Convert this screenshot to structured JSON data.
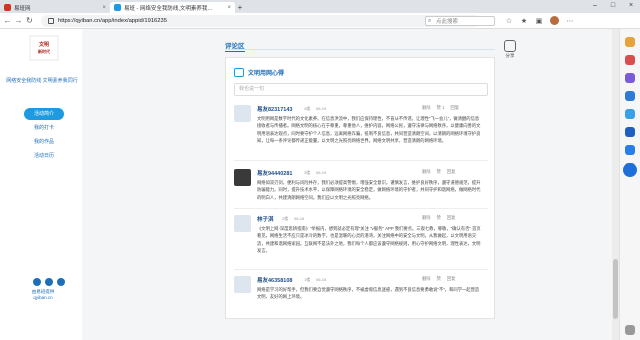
{
  "browser": {
    "tabs": [
      {
        "title": "易班网",
        "active": false
      },
      {
        "title": "易班 - 网络安全我防线,文明素养我…",
        "active": true
      }
    ],
    "url": "https://qyiban.cn/app/index/appid/1916235",
    "search_placeholder": "点此搜索"
  },
  "sidebar": {
    "logo_text": "文明新时代",
    "site_name": "网络安全我防线 文明素养我同行",
    "menu": [
      "活动简介",
      "我的打卡",
      "我的作品",
      "活动日历"
    ],
    "footer_line1": "由易班提供",
    "footer_line2": "qyiban.cn"
  },
  "main": {
    "section_title": "评论区",
    "share_label": "分享",
    "card_title": "文明用网心得",
    "input_placeholder": "我也说一句",
    "posts": [
      {
        "name": "易友82317143",
        "meta1": "4楼",
        "meta2": "06-19",
        "actions": [
          "删除",
          "赞 1",
          "回复"
        ],
        "body": "文明用网是数字时代的文化素养。在信息洪流中，我们应保持理性，不盲从不传谣，让理性\"飞一会儿\"，做清醒的信息接收者与传播者。网络文明的核心在于尊重，尊重他人，维护内容。网络公民，遵守法律与网络秩序，以健康向善的文明用语表达观点，同时要守护个人信息，远离网络诈骗，抵制不良信息，共同营造清朗空间，以清朗的网络环境守护良知，让每一条评论都传递正能量，以文明之光照亮网络世界。网络文明共享，营造清朗的网络环境。"
      },
      {
        "name": "易友94440281",
        "meta1": "3楼",
        "meta2": "06-19",
        "actions": [
          "删除",
          "赞",
          "回复"
        ],
        "body": "网络如双刃剑，便利与风险并存，我们必须提高警惕，增强安全意识，谨慎发言，维护良好秩序，遵守道德规范，提升防骗能力。同时，提升技术水平，以保障网络环境的安全稳定，做网络环境的守护者，共同守护和谐网络，做网络时代的明白人，共建清朗网络空间。我们应以文明之光照亮网络。"
      },
      {
        "name": "林子淇",
        "meta1": "2楼",
        "meta2": "06-16",
        "actions": [
          "删除",
          "赞",
          "回复"
        ],
        "body": "《文明上网·深度思辨指南》\"举报内，想到就必定有理\"关注 \"v服务\" APP 我们要点。三观七教，尊敬，\"确认有否\" 首页看见。网络生活不应只是冰冷的数字，也是温暖的心灵的港湾，关注网络中的安全与文明，从我做起，以文明用语交流，共建和谐网络家园。互联网不是法外之地，我们每个人都应该遵守网络规则，用心守护网络文明，理性表达，文明发言。"
      },
      {
        "name": "易友46358108",
        "meta1": "1楼",
        "meta2": "06-15",
        "actions": [
          "删除",
          "赞",
          "回复"
        ],
        "body": "网络是学习的好帮手，但我们要自觉遵守网络秩序，不被虚假信息迷惑，遇到不良信息要勇敢说\"不\"，和同学一起营造文明、友好的网上环境。"
      }
    ]
  }
}
